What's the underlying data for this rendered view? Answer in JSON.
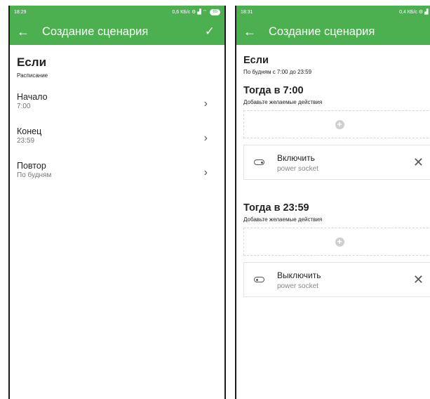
{
  "left": {
    "status": {
      "time": "18:29",
      "right": "0,6 КБ/с ⚙ ▟ ⌔",
      "battery": "65"
    },
    "appbar": {
      "title": "Создание сценария"
    },
    "if_title": "Если",
    "if_sub": "Расписание",
    "rows": [
      {
        "label": "Начало",
        "value": "7:00"
      },
      {
        "label": "Конец",
        "value": "23:59"
      },
      {
        "label": "Повтор",
        "value": "По будням"
      }
    ]
  },
  "right": {
    "status": {
      "time": "18:31",
      "right": "0,4 КБ/с ⚙ ▟ ⌔"
    },
    "appbar": {
      "title": "Создание сценария"
    },
    "if_title": "Если",
    "if_sub": "По будням с 7:00 до 23:59",
    "sections": [
      {
        "title": "Тогда в 7:00",
        "hint": "Добавьте желаемые действия",
        "action": {
          "name": "Включить",
          "device": "power socket"
        }
      },
      {
        "title": "Тогда в 23:59",
        "hint": "Добавьте желаемые действия",
        "action": {
          "name": "Выключить",
          "device": "power socket"
        }
      }
    ]
  }
}
